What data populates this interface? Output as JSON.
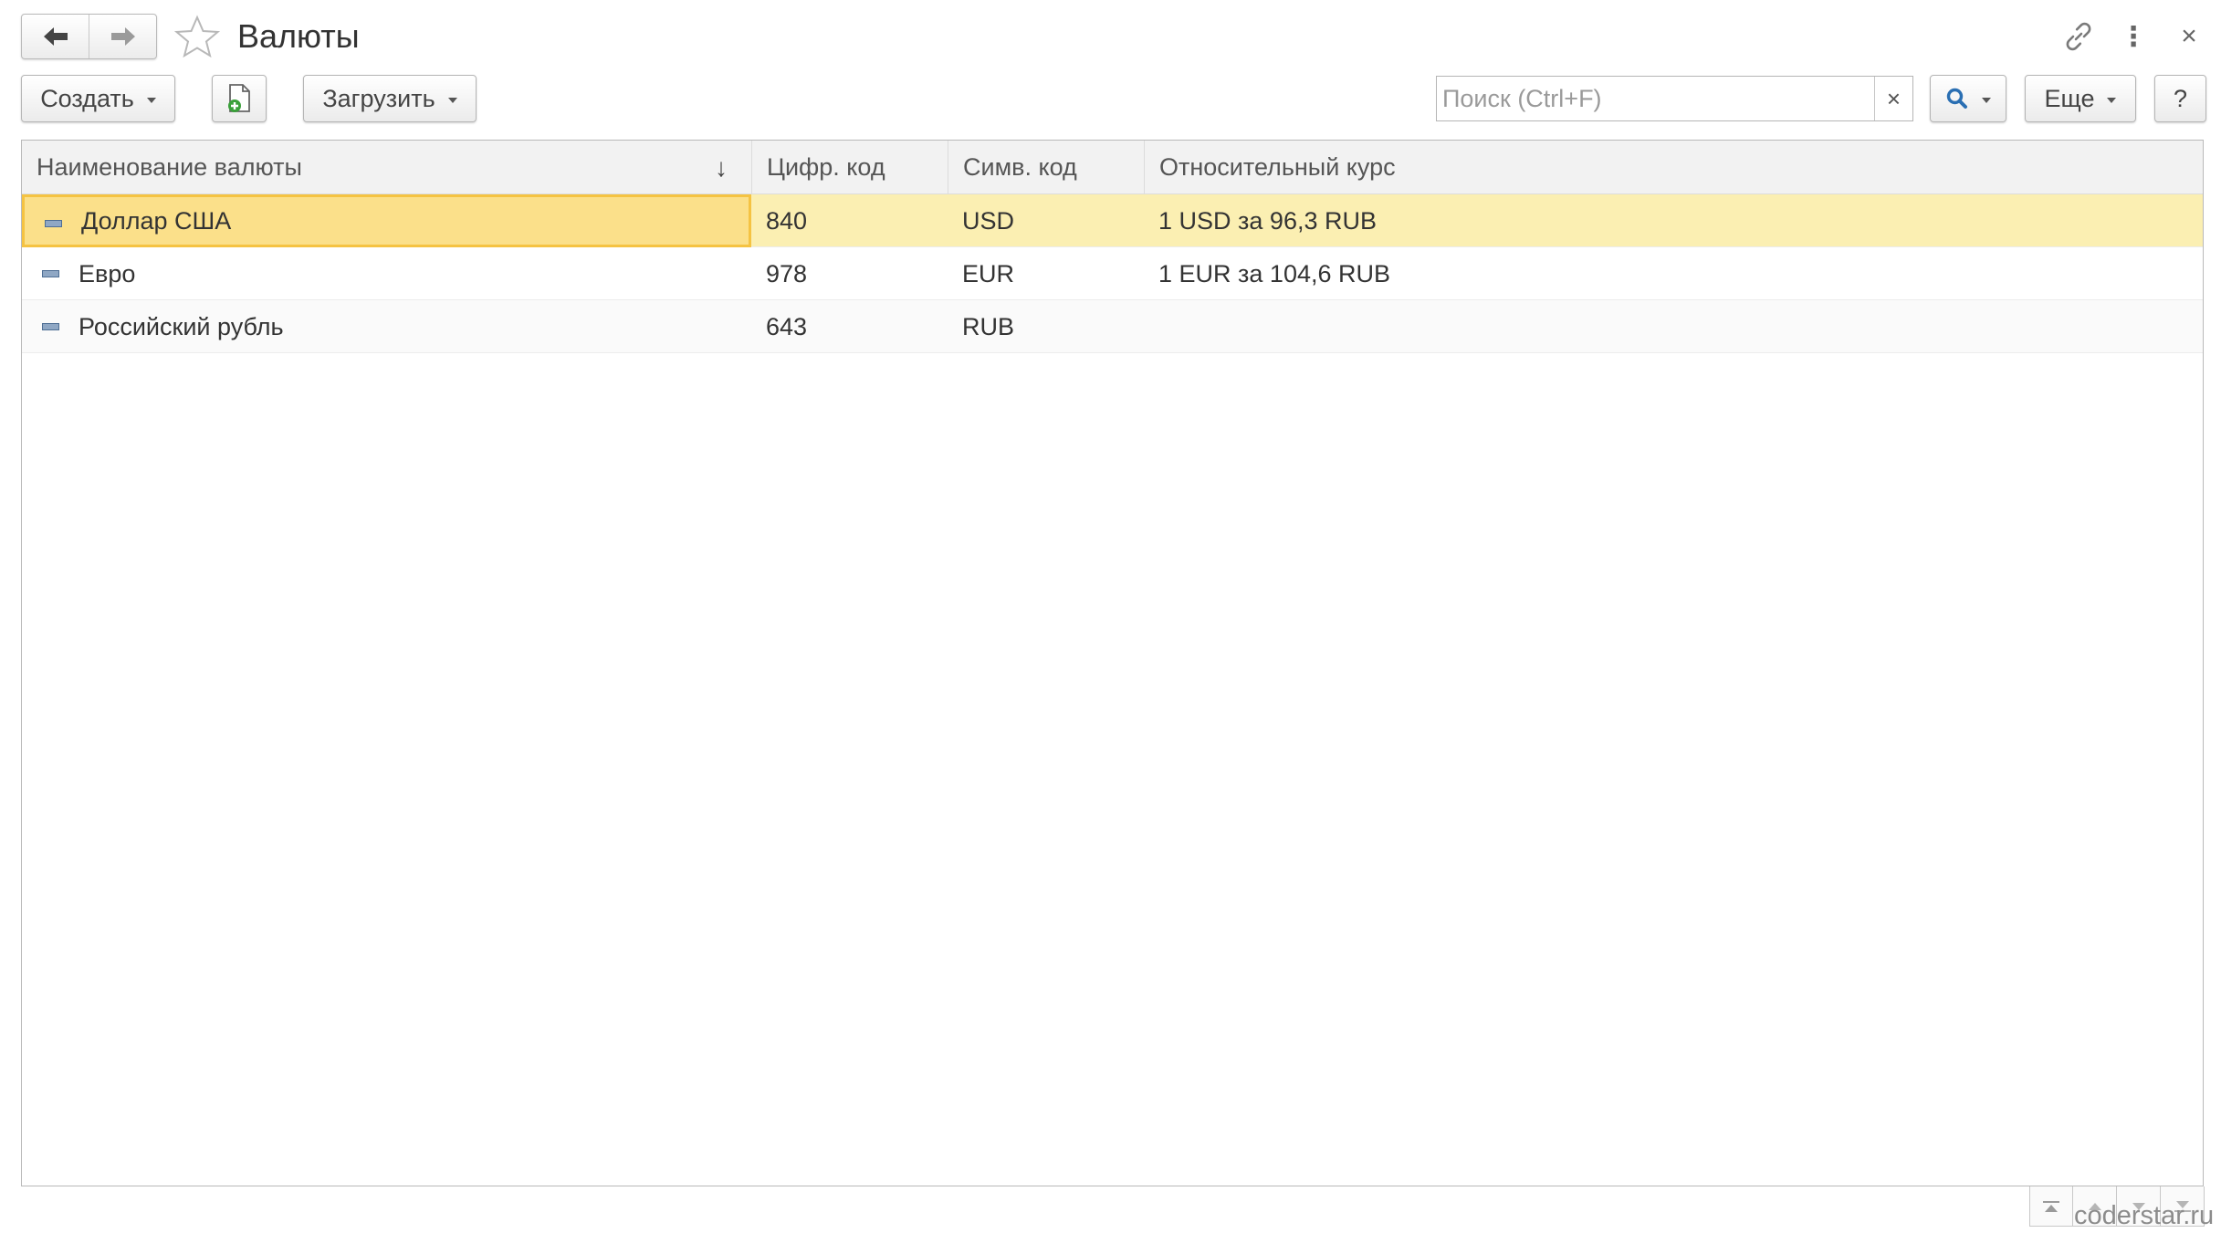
{
  "window": {
    "title": "Валюты",
    "icons": {
      "back": "arrow-left-icon",
      "forward": "arrow-right-icon",
      "favorite": "star-icon",
      "link": "link-icon",
      "more": "vertical-dots-icon",
      "close": "close-icon"
    },
    "close_glyph": "×",
    "more_glyph": "⋮"
  },
  "toolbar": {
    "create_label": "Создать",
    "load_label": "Загрузить",
    "more_label": "Еще",
    "help_label": "?",
    "search": {
      "placeholder": "Поиск (Ctrl+F)",
      "value": "",
      "clear_glyph": "×"
    }
  },
  "table": {
    "columns": [
      {
        "label": "Наименование валюты",
        "sort": "↓"
      },
      {
        "label": "Цифр. код"
      },
      {
        "label": "Симв. код"
      },
      {
        "label": "Относительный курс"
      }
    ],
    "rows": [
      {
        "name": "Доллар США",
        "num_code": "840",
        "sym_code": "USD",
        "rate": "1 USD за 96,3 RUB",
        "selected": true
      },
      {
        "name": "Евро",
        "num_code": "978",
        "sym_code": "EUR",
        "rate": "1 EUR за 104,6 RUB",
        "selected": false
      },
      {
        "name": "Российский рубль",
        "num_code": "643",
        "sym_code": "RUB",
        "rate": "",
        "selected": false
      }
    ]
  },
  "footer": {
    "watermark": "coderstar.ru"
  },
  "colors": {
    "selected_row": "#fbefb2",
    "focused_cell": "#fbe08a",
    "focus_border": "#f5c342",
    "search_icon": "#2a6fb3",
    "add_icon": "#3aa03a"
  }
}
